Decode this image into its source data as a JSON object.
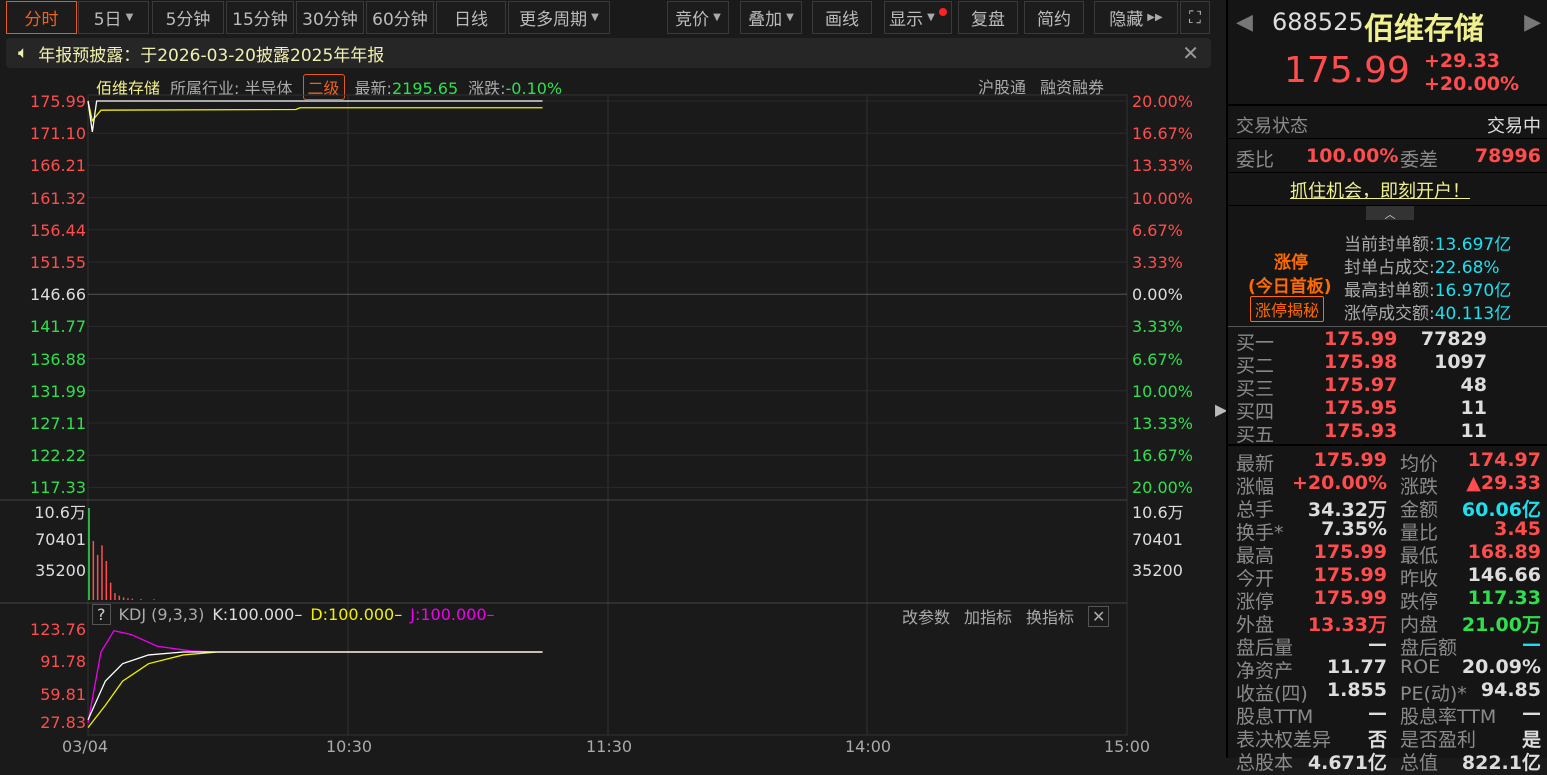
{
  "toolbar": {
    "tabs": [
      "分时",
      "5日",
      "5分钟",
      "15分钟",
      "30分钟",
      "60分钟",
      "日线",
      "更多周期"
    ],
    "right": [
      "竞价",
      "叠加",
      "画线",
      "显示",
      "复盘",
      "简约",
      "隐藏"
    ]
  },
  "notice": {
    "text": "年报预披露：于2026-03-20披露2025年年报"
  },
  "info": {
    "name": "佰维存储",
    "industry_label": "所属行业:",
    "industry": "半导体",
    "level": "二级",
    "latest_label": "最新:",
    "latest": "2195.65",
    "change_label": "涨跌:",
    "change": "-0.10%",
    "links": [
      "沪股通",
      "融资融券"
    ]
  },
  "price_axis": {
    "left": [
      "175.99",
      "171.10",
      "166.21",
      "161.32",
      "156.44",
      "151.55",
      "146.66",
      "141.77",
      "136.88",
      "131.99",
      "127.11",
      "122.22",
      "117.33"
    ],
    "right": [
      "20.00%",
      "16.67%",
      "13.33%",
      "10.00%",
      "6.67%",
      "3.33%",
      "0.00%",
      "3.33%",
      "6.67%",
      "10.00%",
      "13.33%",
      "16.67%",
      "20.00%"
    ]
  },
  "vol_axis": {
    "left": [
      "10.6万",
      "70401",
      "35200"
    ],
    "right": [
      "10.6万",
      "70401",
      "35200"
    ]
  },
  "kdj": {
    "help": "?",
    "title": "KDJ (9,3,3)",
    "k": "K:100.000–",
    "d": "D:100.000–",
    "j": "J:100.000–",
    "buttons": [
      "改参数",
      "加指标",
      "换指标"
    ],
    "axis": [
      "123.76",
      "91.78",
      "59.81",
      "27.83"
    ]
  },
  "time_axis": [
    "03/04",
    "10:30",
    "11:30",
    "14:00",
    "15:00"
  ],
  "chart_data": {
    "type": "line",
    "prev_close": 146.66,
    "ylim": [
      117.33,
      175.99
    ],
    "minutes_total": 240,
    "price": [
      [
        0,
        175.99
      ],
      [
        1,
        171.3
      ],
      [
        2,
        175.99
      ],
      [
        105,
        175.99
      ]
    ],
    "avg": [
      [
        0,
        175.99
      ],
      [
        1,
        173.0
      ],
      [
        3,
        174.6
      ],
      [
        48,
        174.7
      ],
      [
        49,
        174.97
      ],
      [
        105,
        174.97
      ]
    ],
    "volume": {
      "ymax": 106000,
      "values": [
        [
          0,
          106000
        ],
        [
          1,
          68000
        ],
        [
          2,
          52000
        ],
        [
          3,
          63000
        ],
        [
          4,
          45000
        ],
        [
          5,
          20000
        ],
        [
          6,
          8000
        ],
        [
          7,
          5000
        ],
        [
          8,
          3000
        ],
        [
          9,
          2000
        ],
        [
          10,
          1500
        ],
        [
          12,
          1000
        ],
        [
          15,
          800
        ]
      ]
    },
    "kdj": {
      "ylim": [
        20,
        130
      ],
      "K": [
        [
          0,
          30
        ],
        [
          4,
          70
        ],
        [
          8,
          88
        ],
        [
          14,
          97
        ],
        [
          22,
          100
        ],
        [
          105,
          100
        ]
      ],
      "D": [
        [
          0,
          22
        ],
        [
          4,
          45
        ],
        [
          8,
          70
        ],
        [
          14,
          88
        ],
        [
          22,
          97
        ],
        [
          30,
          100
        ],
        [
          105,
          100
        ]
      ],
      "J": [
        [
          0,
          27
        ],
        [
          3,
          100
        ],
        [
          6,
          122
        ],
        [
          10,
          118
        ],
        [
          16,
          106
        ],
        [
          24,
          101
        ],
        [
          30,
          100
        ],
        [
          105,
          100
        ]
      ]
    }
  },
  "quote": {
    "code": "688525",
    "name": "佰维存储",
    "price": "175.99",
    "change": "+29.33",
    "pct": "+20.00%",
    "status_label": "交易状态",
    "status": "交易中",
    "wb_label": "委比",
    "wb": "100.00%",
    "wc_label": "委差",
    "wc": "78996",
    "promo": "抓住机会，即刻开户！",
    "limit_title": "涨停",
    "limit_sub": "(今日首板)",
    "limit_btn": "涨停揭秘",
    "seal": [
      [
        "当前封单额:",
        "13.697亿"
      ],
      [
        "封单占成交:",
        "22.68%"
      ],
      [
        "最高封单额:",
        "16.970亿"
      ],
      [
        "涨停成交额:",
        "40.113亿"
      ]
    ],
    "bids": [
      [
        "买一",
        "175.99",
        "77829"
      ],
      [
        "买二",
        "175.98",
        "1097"
      ],
      [
        "买三",
        "175.97",
        "48"
      ],
      [
        "买四",
        "175.95",
        "11"
      ],
      [
        "买五",
        "175.93",
        "11"
      ]
    ],
    "stats": [
      [
        "最新",
        "175.99",
        "red",
        "均价",
        "174.97",
        "red"
      ],
      [
        "涨幅",
        "+20.00%",
        "red",
        "涨跌",
        "▲29.33",
        "red"
      ],
      [
        "总手",
        "34.32万",
        "wht",
        "金额",
        "60.06亿",
        "cyan"
      ],
      [
        "换手*",
        "7.35%",
        "wht",
        "量比",
        "3.45",
        "red"
      ],
      [
        "最高",
        "175.99",
        "red",
        "最低",
        "168.89",
        "red"
      ],
      [
        "今开",
        "175.99",
        "red",
        "昨收",
        "146.66",
        "wht"
      ],
      [
        "涨停",
        "175.99",
        "red",
        "跌停",
        "117.33",
        "grn"
      ],
      [
        "外盘",
        "13.33万",
        "red",
        "内盘",
        "21.00万",
        "grn"
      ],
      [
        "盘后量",
        "—",
        "wht",
        "盘后额",
        "—",
        "cyan"
      ],
      [
        "净资产",
        "11.77",
        "wht",
        "ROE",
        "20.09%",
        "wht"
      ],
      [
        "收益(四)",
        "1.855",
        "wht",
        "PE(动)*",
        "94.85",
        "wht"
      ],
      [
        "股息TTM",
        "—",
        "wht",
        "股息率TTM",
        "—",
        "wht"
      ],
      [
        "表决权差异",
        "否",
        "wht",
        "是否盈利",
        "是",
        "wht"
      ],
      [
        "总股本",
        "4.671亿",
        "wht",
        "总值",
        "822.1亿",
        "wht"
      ]
    ]
  }
}
